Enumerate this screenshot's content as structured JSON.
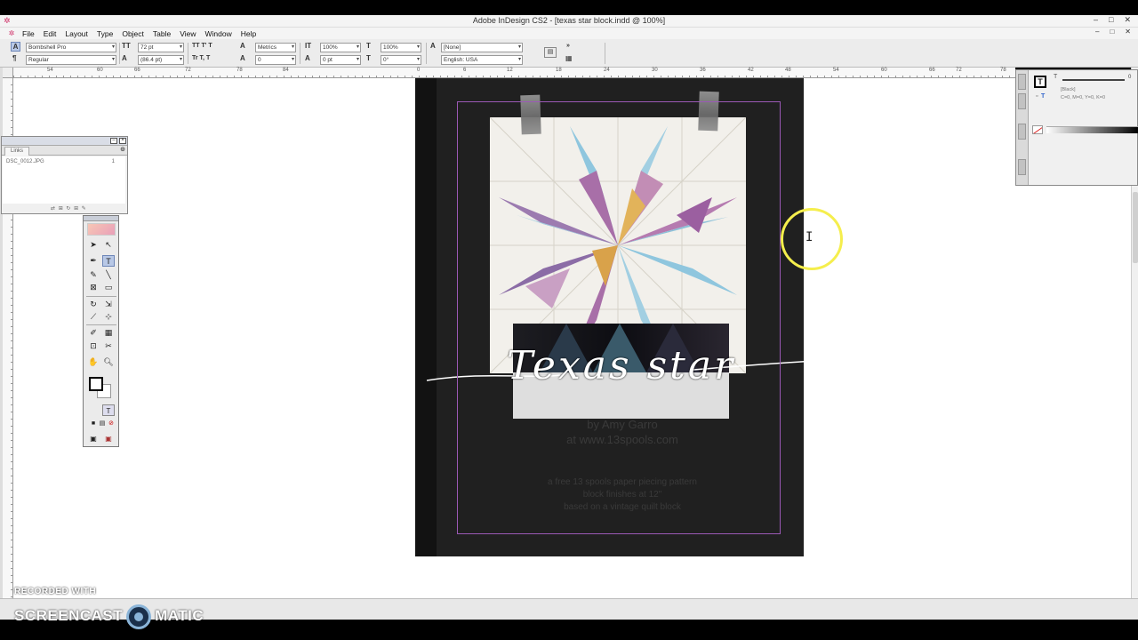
{
  "window": {
    "title": "Adobe InDesign CS2 - [texas star block.indd @ 100%]",
    "controls": [
      "–",
      "□",
      "✕"
    ]
  },
  "menubar": {
    "items": [
      "File",
      "Edit",
      "Layout",
      "Type",
      "Object",
      "Table",
      "View",
      "Window",
      "Help"
    ],
    "doc_controls": [
      "–",
      "□",
      "✕"
    ]
  },
  "control_panel": {
    "font_family": "Bombshell Pro",
    "font_style": "Regular",
    "font_size": "72 pt",
    "leading": "(86.4 pt)",
    "kerning": "Metrics",
    "tracking": "0",
    "vertical_scale": "100%",
    "horizontal_scale": "100%",
    "baseline_shift": "0 pt",
    "skew": "0°",
    "char_style": "[None]",
    "language": "English: USA"
  },
  "ruler": {
    "h_labels": [
      "54",
      "60",
      "66",
      "72",
      "78",
      "84",
      "0",
      "6",
      "12",
      "18",
      "24",
      "30",
      "36",
      "42",
      "48",
      "54",
      "60",
      "66",
      "72",
      "78"
    ]
  },
  "links_panel": {
    "tab": "Links",
    "item_name": "DSC_0012.JPG",
    "item_num": "1"
  },
  "document": {
    "script_title": "Texas star",
    "byline_1": "by Amy Garro",
    "byline_2": "at www.13spools.com",
    "desc_1": "a free 13 spools paper piecing pattern",
    "desc_2": "block finishes at 12\"",
    "desc_3": "based on a vintage quilt block"
  },
  "color_panel": {
    "slider_value": "0",
    "swatch_name": "[Black]",
    "cmyk": "C=0, M=0, Y=0, K=0"
  },
  "watermark": {
    "recorded": "RECORDED WITH",
    "brand_left": "SCREENCAST",
    "brand_right": "MATIC"
  },
  "colors": {
    "margin_guide": "#9b59b6",
    "page_bg": "#202020",
    "cursor_highlight": "#f5ee4d"
  }
}
